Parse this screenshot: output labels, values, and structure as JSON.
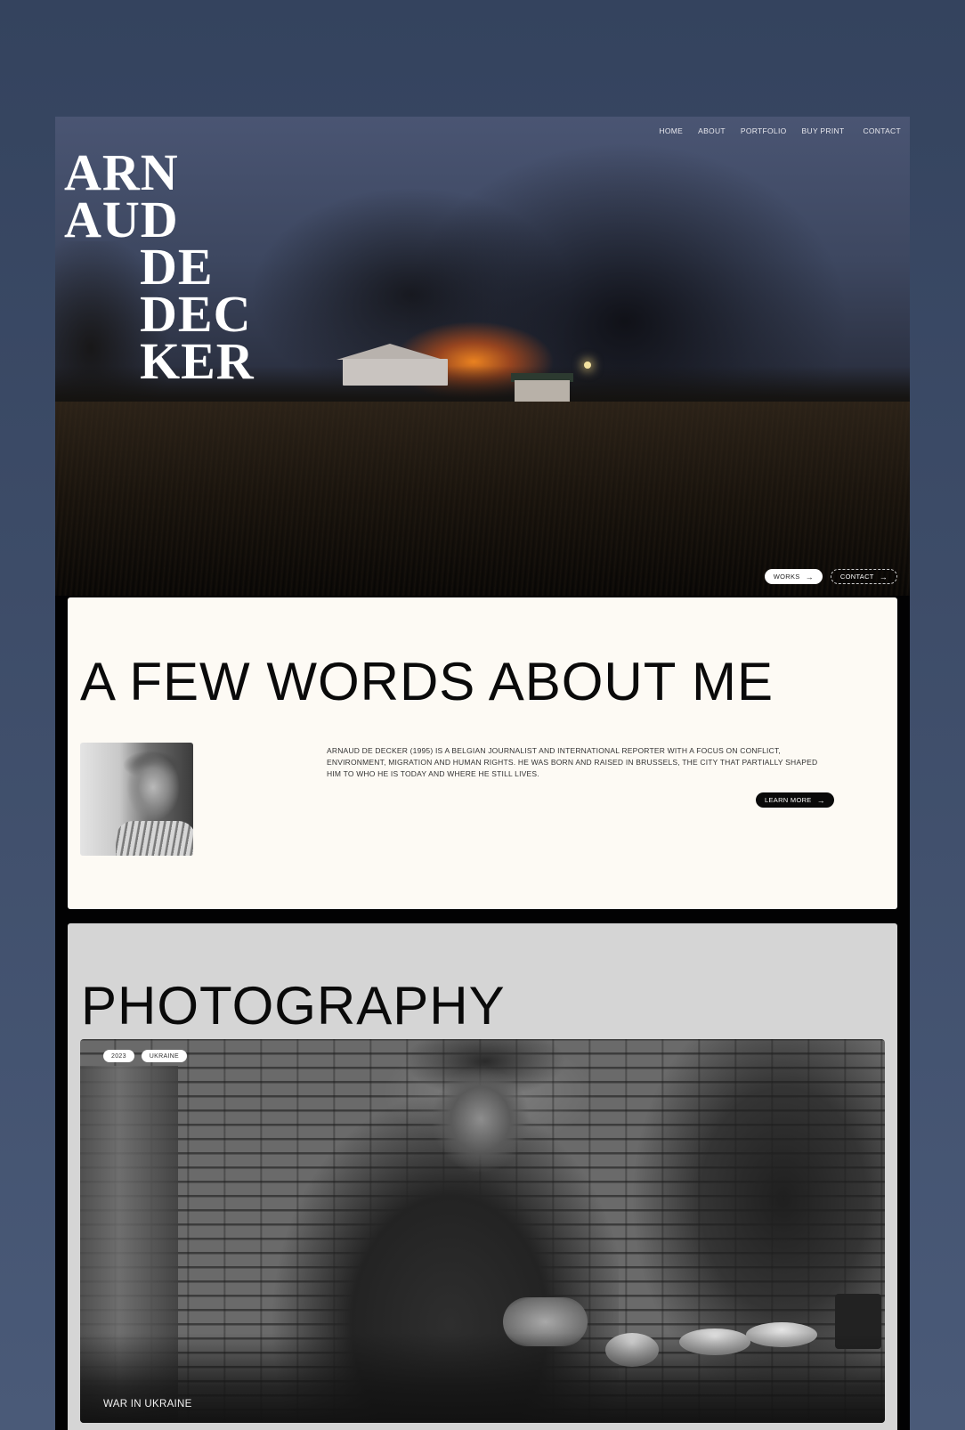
{
  "brand": {
    "logo_lines": [
      "ARN",
      "AUD",
      "DE",
      "DEC",
      "KER"
    ]
  },
  "nav": {
    "items": [
      "HOME",
      "ABOUT",
      "PORTFOLIO",
      "BUY PRINT",
      "CONTACT"
    ]
  },
  "hero": {
    "works_label": "WORKS",
    "contact_label": "CONTACT",
    "arrow_icon": "arrow-right-icon"
  },
  "about": {
    "heading": "A FEW WORDS ABOUT ME",
    "bio": "ARNAUD DE DECKER (1995) IS A BELGIAN JOURNALIST AND INTERNATIONAL REPORTER WITH A FOCUS ON CONFLICT, ENVIRONMENT, MIGRATION AND HUMAN RIGHTS. HE WAS BORN AND RAISED IN BRUSSELS, THE CITY THAT PARTIALLY SHAPED HIM TO WHO HE IS TODAY AND WHERE HE STILL LIVES.",
    "learn_more_label": "LEARN MORE"
  },
  "photography": {
    "heading": "PHOTOGRAPHY",
    "card": {
      "tags": [
        "2023",
        "UKRAINE"
      ],
      "caption": "WAR IN UKRAINE"
    }
  },
  "colors": {
    "page_bg": "#3d4c68",
    "about_bg": "#fdfaf4",
    "photography_bg": "#d5d5d5",
    "accent_dark": "#0a0a0a"
  }
}
